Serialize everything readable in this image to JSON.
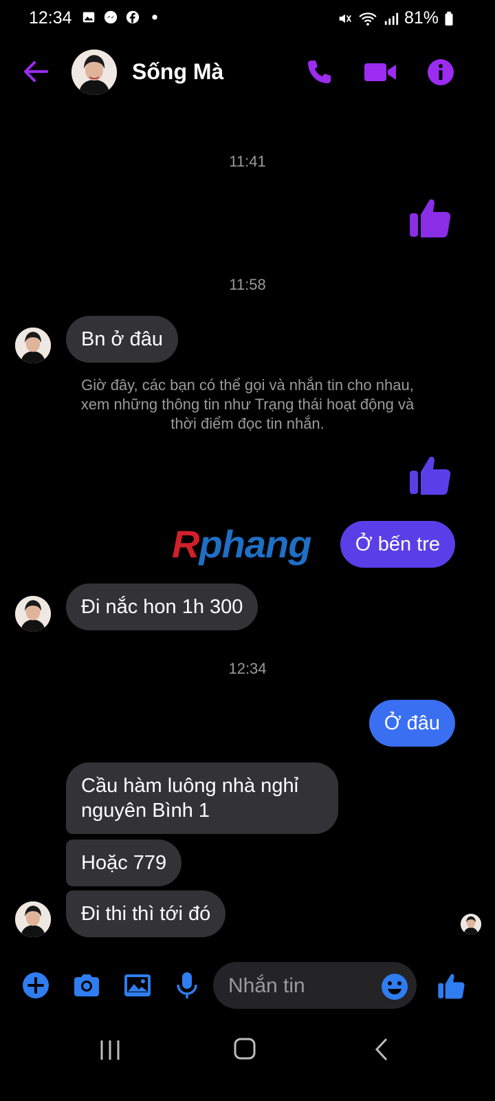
{
  "status_bar": {
    "time": "12:34",
    "battery": "81%"
  },
  "header": {
    "contact_name": "Sống Mà"
  },
  "colors": {
    "accent": "#9b2cf0",
    "outgoing_purple": "#5a3fe8",
    "outgoing_blue": "#3a6ff2",
    "incoming": "#333335",
    "composer_icon": "#2f7df0"
  },
  "timestamps": [
    "11:41",
    "11:58",
    "12:34"
  ],
  "messages": {
    "m1": "Bn ở đâu",
    "m2": "Ở bến tre",
    "m3": "Đi nắc hon 1h 300",
    "m4": "Ở đâu",
    "m5": "Cầu hàm luông nhà nghỉ nguyên Bình 1",
    "m6": "Hoặc 779",
    "m7": "Đi thi thì tới đó"
  },
  "notice": "Giờ đây, các bạn có thể gọi và nhắn tin cho nhau, xem những thông tin như Trạng thái hoạt động và thời điểm đọc tin nhắn.",
  "watermark": {
    "first": "R",
    "rest": "phang"
  },
  "composer": {
    "placeholder": "Nhắn tin"
  }
}
